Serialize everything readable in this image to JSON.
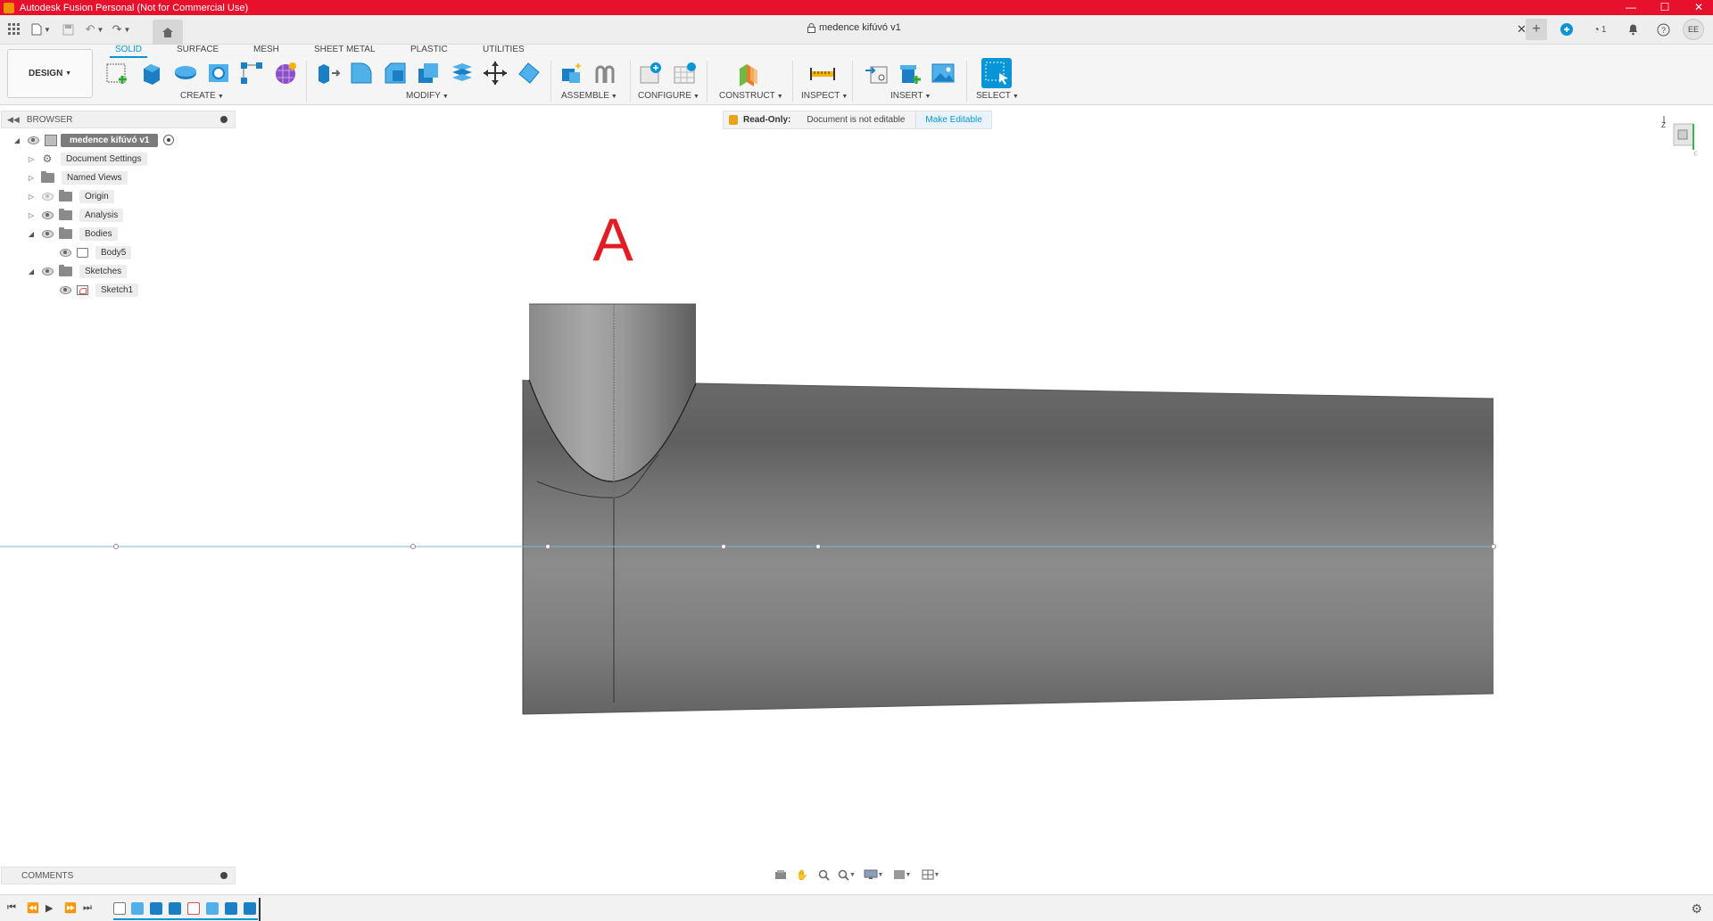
{
  "window": {
    "title": "Autodesk Fusion Personal (Not for Commercial Use)",
    "controls": [
      "—",
      "☐",
      "✕"
    ]
  },
  "tabbar": {
    "document_title": "medence kifúvó v1",
    "notifications_count": "1",
    "user_initials": "EE"
  },
  "ribbon": {
    "workspace": "DESIGN",
    "tabs": [
      "SOLID",
      "SURFACE",
      "MESH",
      "SHEET METAL",
      "PLASTIC",
      "UTILITIES"
    ],
    "active_tab": "SOLID",
    "groups": [
      "CREATE",
      "MODIFY",
      "ASSEMBLE",
      "CONFIGURE",
      "CONSTRUCT",
      "INSPECT",
      "INSERT",
      "SELECT"
    ]
  },
  "browser": {
    "title": "BROWSER",
    "root": "medence kifúvó v1",
    "items": [
      {
        "label": "Document Settings",
        "icon": "gear-icon"
      },
      {
        "label": "Named Views",
        "icon": "folder-icon"
      },
      {
        "label": "Origin",
        "icon": "folder-icon"
      },
      {
        "label": "Analysis",
        "icon": "folder-icon"
      },
      {
        "label": "Bodies",
        "icon": "folder-icon"
      },
      {
        "label": "Body5",
        "icon": "body-icon"
      },
      {
        "label": "Sketches",
        "icon": "folder-icon"
      },
      {
        "label": "Sketch1",
        "icon": "sketch-icon"
      }
    ]
  },
  "readonly_banner": {
    "label": "Read-Only:",
    "message": "Document is not editable",
    "action": "Make Editable"
  },
  "viewport": {
    "annotation": "A",
    "annotation_color": "#e31c24",
    "body_color": "#7a7a7a",
    "sketch_line_color": "#7fb6d6"
  },
  "viewcube": {
    "axis_label": "Z"
  },
  "comments": {
    "title": "COMMENTS"
  },
  "colors": {
    "titlebar": "#e8112d",
    "accent": "#0696d7"
  }
}
